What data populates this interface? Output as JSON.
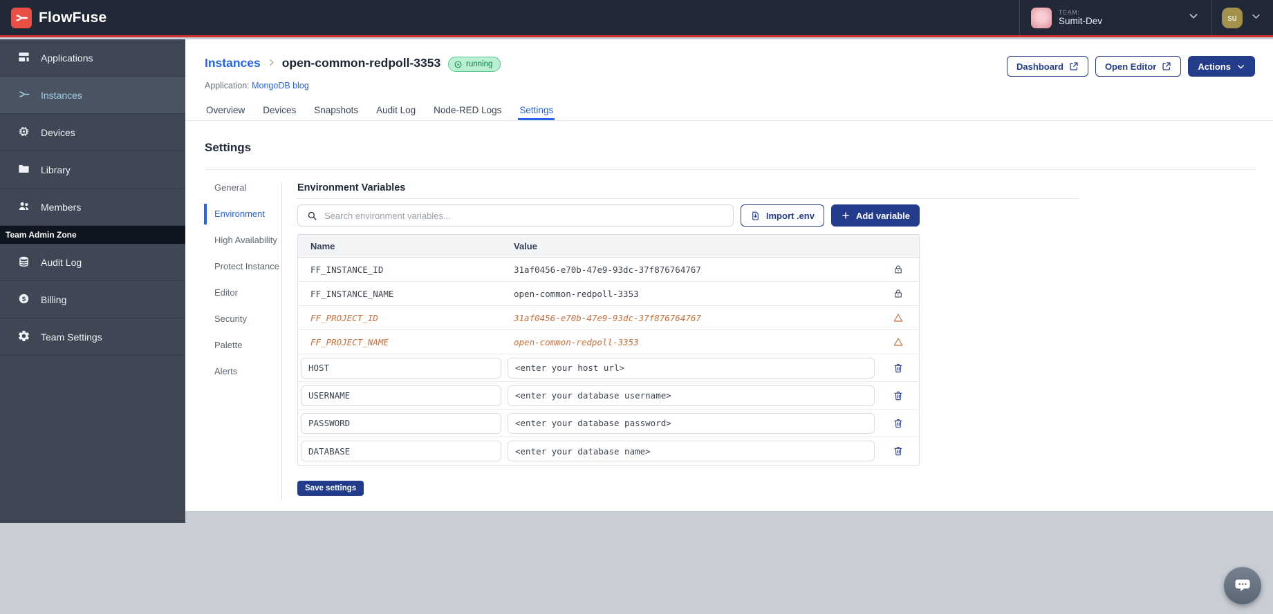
{
  "navbar": {
    "brand": "FlowFuse",
    "team_label": "TEAM:",
    "team_name": "Sumit-Dev",
    "user_initials": "su"
  },
  "sidebar": {
    "items": [
      {
        "label": "Applications",
        "icon": "applications-icon"
      },
      {
        "label": "Instances",
        "icon": "instances-icon"
      },
      {
        "label": "Devices",
        "icon": "devices-icon"
      },
      {
        "label": "Library",
        "icon": "library-icon"
      },
      {
        "label": "Members",
        "icon": "members-icon"
      }
    ],
    "active_item": "Instances",
    "admin_zone_label": "Team Admin Zone",
    "admin_items": [
      {
        "label": "Audit Log",
        "icon": "audit-log-icon"
      },
      {
        "label": "Billing",
        "icon": "billing-icon"
      },
      {
        "label": "Team Settings",
        "icon": "team-settings-icon"
      }
    ]
  },
  "header": {
    "breadcrumb_parent": "Instances",
    "title": "open-common-redpoll-3353",
    "status": "running",
    "application_label": "Application:",
    "application_name": "MongoDB blog",
    "buttons": {
      "dashboard": "Dashboard",
      "open_editor": "Open Editor",
      "actions": "Actions"
    }
  },
  "tabs": [
    "Overview",
    "Devices",
    "Snapshots",
    "Audit Log",
    "Node-RED Logs",
    "Settings"
  ],
  "active_tab": "Settings",
  "settings": {
    "title": "Settings",
    "nav": [
      "General",
      "Environment",
      "High Availability",
      "Protect Instance",
      "Editor",
      "Security",
      "Palette",
      "Alerts"
    ],
    "active_nav": "Environment"
  },
  "environment": {
    "title": "Environment Variables",
    "search_placeholder": "Search environment variables...",
    "import_button": "Import .env",
    "add_button": "Add variable",
    "columns": [
      "Name",
      "Value"
    ],
    "rows_locked": [
      {
        "name": "FF_INSTANCE_ID",
        "value": "31af0456-e70b-47e9-93dc-37f876764767"
      },
      {
        "name": "FF_INSTANCE_NAME",
        "value": "open-common-redpoll-3353"
      }
    ],
    "rows_warning": [
      {
        "name": "FF_PROJECT_ID",
        "value": "31af0456-e70b-47e9-93dc-37f876764767"
      },
      {
        "name": "FF_PROJECT_NAME",
        "value": "open-common-redpoll-3353"
      }
    ],
    "rows_editable": [
      {
        "name": "HOST",
        "value": "<enter your host url>"
      },
      {
        "name": "USERNAME",
        "value": "<enter your database username>"
      },
      {
        "name": "PASSWORD",
        "value": "<enter your database password>"
      },
      {
        "name": "DATABASE",
        "value": "<enter your database name>"
      }
    ],
    "save_button": "Save settings"
  },
  "colors": {
    "navbar_bg": "#212938",
    "accent_red": "#d5302c",
    "brand_red": "#ea4f46",
    "sidebar_bg": "#3f4755",
    "sidebar_active_text": "#9fd0ea",
    "link_blue": "#2563eb",
    "button_navy": "#243c8c",
    "badge_green_bg": "#b9f0d2",
    "badge_green_text": "#0e7a4c",
    "warning_orange": "#c9713c"
  }
}
